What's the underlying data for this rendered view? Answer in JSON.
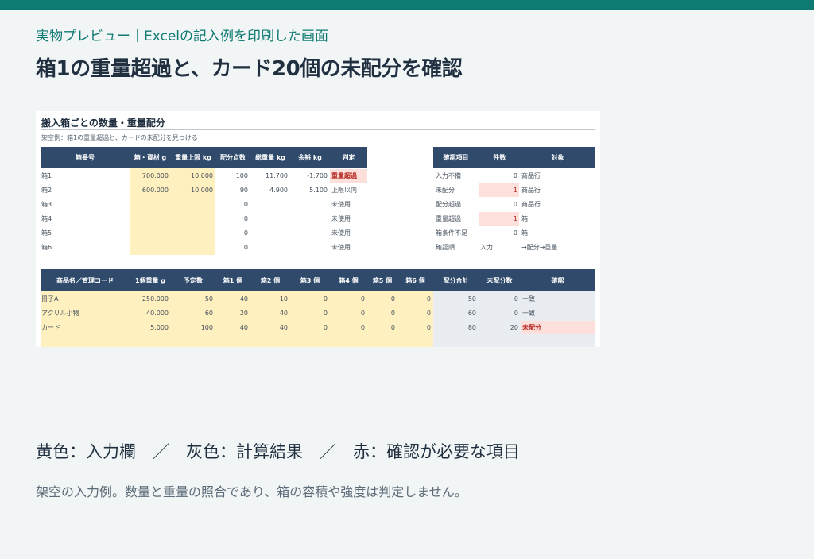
{
  "kicker": "実物プレビュー｜Excelの記入例を印刷した画面",
  "headline": "箱1の重量超過と、カード20個の未配分を確認",
  "sheet": {
    "title": "搬入箱ごとの数量・重量配分",
    "note": "架空例：箱1の重量超過と、カードの未配分を見つける",
    "box_table": {
      "headers": [
        "箱番号",
        "箱・資材 g",
        "重量上限 kg",
        "配分点数",
        "総重量 kg",
        "余裕 kg",
        "判定"
      ],
      "rows": [
        [
          "箱1",
          "700.000",
          "10.000",
          "100",
          "11.700",
          "-1.700",
          "重量超過"
        ],
        [
          "箱2",
          "600.000",
          "10.000",
          "90",
          "4.900",
          "5.100",
          "上限以内"
        ],
        [
          "箱3",
          "",
          "",
          "0",
          "",
          "",
          "未使用"
        ],
        [
          "箱4",
          "",
          "",
          "0",
          "",
          "",
          "未使用"
        ],
        [
          "箱5",
          "",
          "",
          "0",
          "",
          "",
          "未使用"
        ],
        [
          "箱6",
          "",
          "",
          "0",
          "",
          "",
          "未使用"
        ]
      ]
    },
    "check_table": {
      "headers": [
        "確認項目",
        "件数",
        "対象"
      ],
      "rows": [
        [
          "入力不備",
          "0",
          "商品行"
        ],
        [
          "未配分",
          "1",
          "商品行"
        ],
        [
          "配分超過",
          "0",
          "商品行"
        ],
        [
          "重量超過",
          "1",
          "箱"
        ],
        [
          "箱条件不足",
          "0",
          "箱"
        ],
        [
          "確認順",
          "入力",
          "→配分→重量"
        ]
      ]
    },
    "item_table": {
      "headers": [
        "商品名／管理コード",
        "1個重量 g",
        "予定数",
        "箱1 個",
        "箱2 個",
        "箱3 個",
        "箱4 個",
        "箱5 個",
        "箱6 個",
        "配分合計",
        "未配分数",
        "確認"
      ],
      "rows": [
        [
          "冊子A",
          "250.000",
          "50",
          "40",
          "10",
          "0",
          "0",
          "0",
          "0",
          "50",
          "0",
          "一致"
        ],
        [
          "アクリル小物",
          "40.000",
          "60",
          "20",
          "40",
          "0",
          "0",
          "0",
          "0",
          "60",
          "0",
          "一致"
        ],
        [
          "カード",
          "5.000",
          "100",
          "40",
          "40",
          "0",
          "0",
          "0",
          "0",
          "80",
          "20",
          "未配分"
        ]
      ]
    }
  },
  "colors": {
    "header_bg": "#2f4a6b",
    "input_yellow": "#fff0bf",
    "calc_gray": "#e9edf2",
    "alert_red": "#fddfdb",
    "alert_text": "#b3261e",
    "accent_teal": "#0f7a72"
  },
  "legend": "黄色：入力欄　／　灰色：計算結果　／　赤：確認が必要な項目",
  "footnote": "架空の入力例。数量と重量の照合であり、箱の容積や強度は判定しません。"
}
